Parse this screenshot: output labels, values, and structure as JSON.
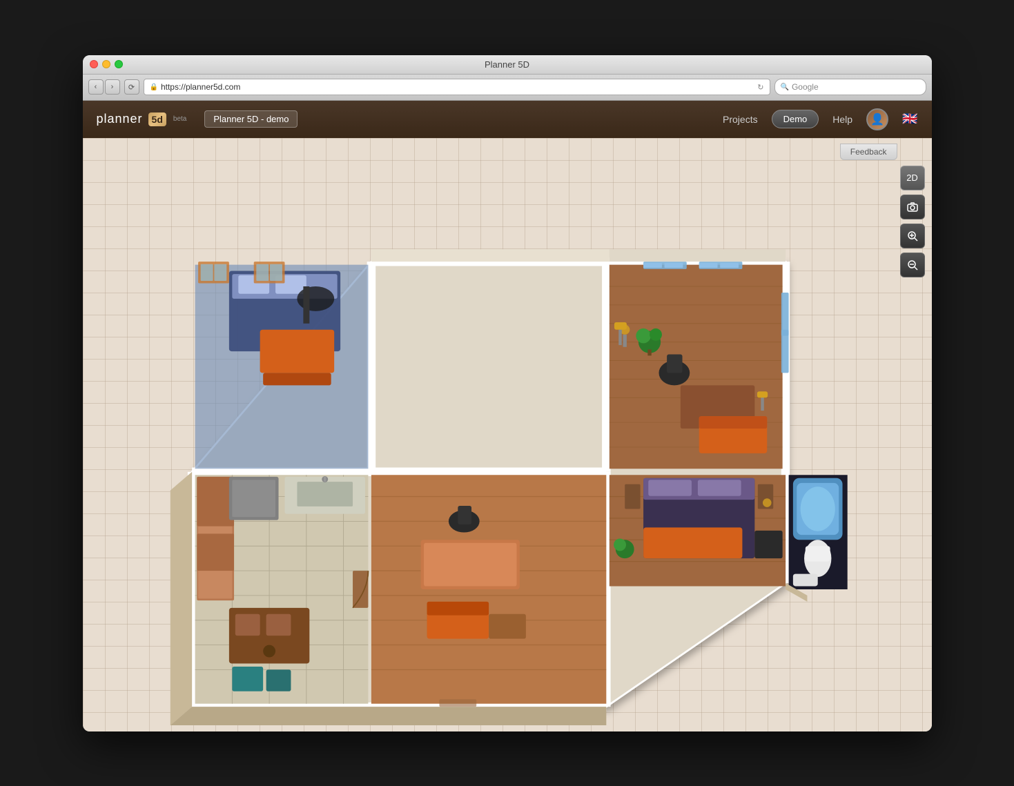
{
  "window": {
    "title": "Planner 5D"
  },
  "browser": {
    "url": "https://planner5d.com",
    "search_placeholder": "Google"
  },
  "header": {
    "logo_text": "planner",
    "logo_5d": "5d",
    "logo_beta": "beta",
    "project_name": "Planner 5D - demo",
    "nav_projects": "Projects",
    "nav_demo": "Demo",
    "nav_help": "Help"
  },
  "toolbar": {
    "feedback_label": "Feedback",
    "btn_2d": "2D",
    "btn_camera": "📷",
    "btn_zoom_in": "🔍+",
    "btn_zoom_out": "🔍-"
  },
  "colors": {
    "bg_grid": "#e8ddd0",
    "header_bg": "#3a2818",
    "wall_color": "#f5f0e8",
    "floor_wood": "#c8956a",
    "floor_tile": "#d8d0c0",
    "floor_dark": "#8b6040",
    "accent_orange": "#d4601a",
    "accent_blue": "#4a7ab5",
    "accent_teal": "#2a8080"
  }
}
